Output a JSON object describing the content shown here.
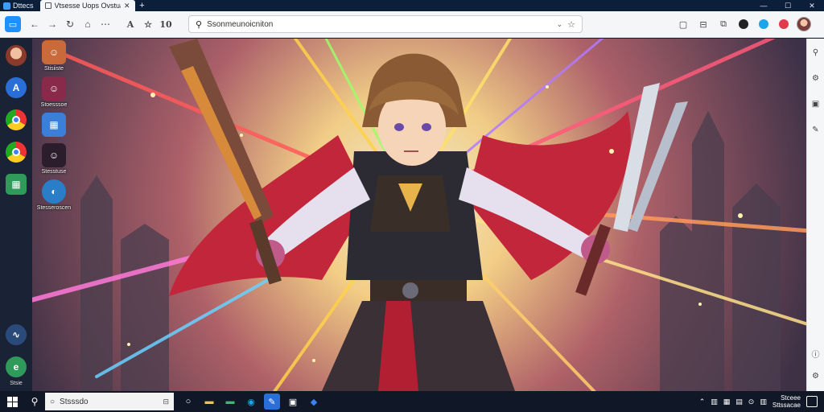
{
  "window": {
    "app_label": "Dttecs",
    "tab_title": "Vtsesse Uops Ovstuae",
    "controls": [
      "—",
      "☐",
      "✕"
    ]
  },
  "toolbar": {
    "ext_icons": [
      "A",
      "☆",
      "10"
    ],
    "address_text": "Ssonmeunoicniton"
  },
  "desktop_icons": [
    {
      "label": "Stisiiste",
      "color": "#c86a3a"
    },
    {
      "label": "Stoesssoe",
      "color": "#8a2a4a"
    },
    {
      "label": "",
      "color": "#3b7fd9"
    },
    {
      "label": "Stesstuse",
      "color": "#2b1d2b"
    },
    {
      "label": "Stesseroscen",
      "color": "#2a7ec8"
    }
  ],
  "dock": {
    "bottom_label": "Stsie"
  },
  "taskbar": {
    "search_placeholder": "Stsssdo",
    "clock_time": "Stceee",
    "clock_date": "Sttssacae"
  },
  "colors": {
    "titlebar": "#0b1e3a",
    "accent": "#1e90ff",
    "taskbar": "#101828"
  }
}
